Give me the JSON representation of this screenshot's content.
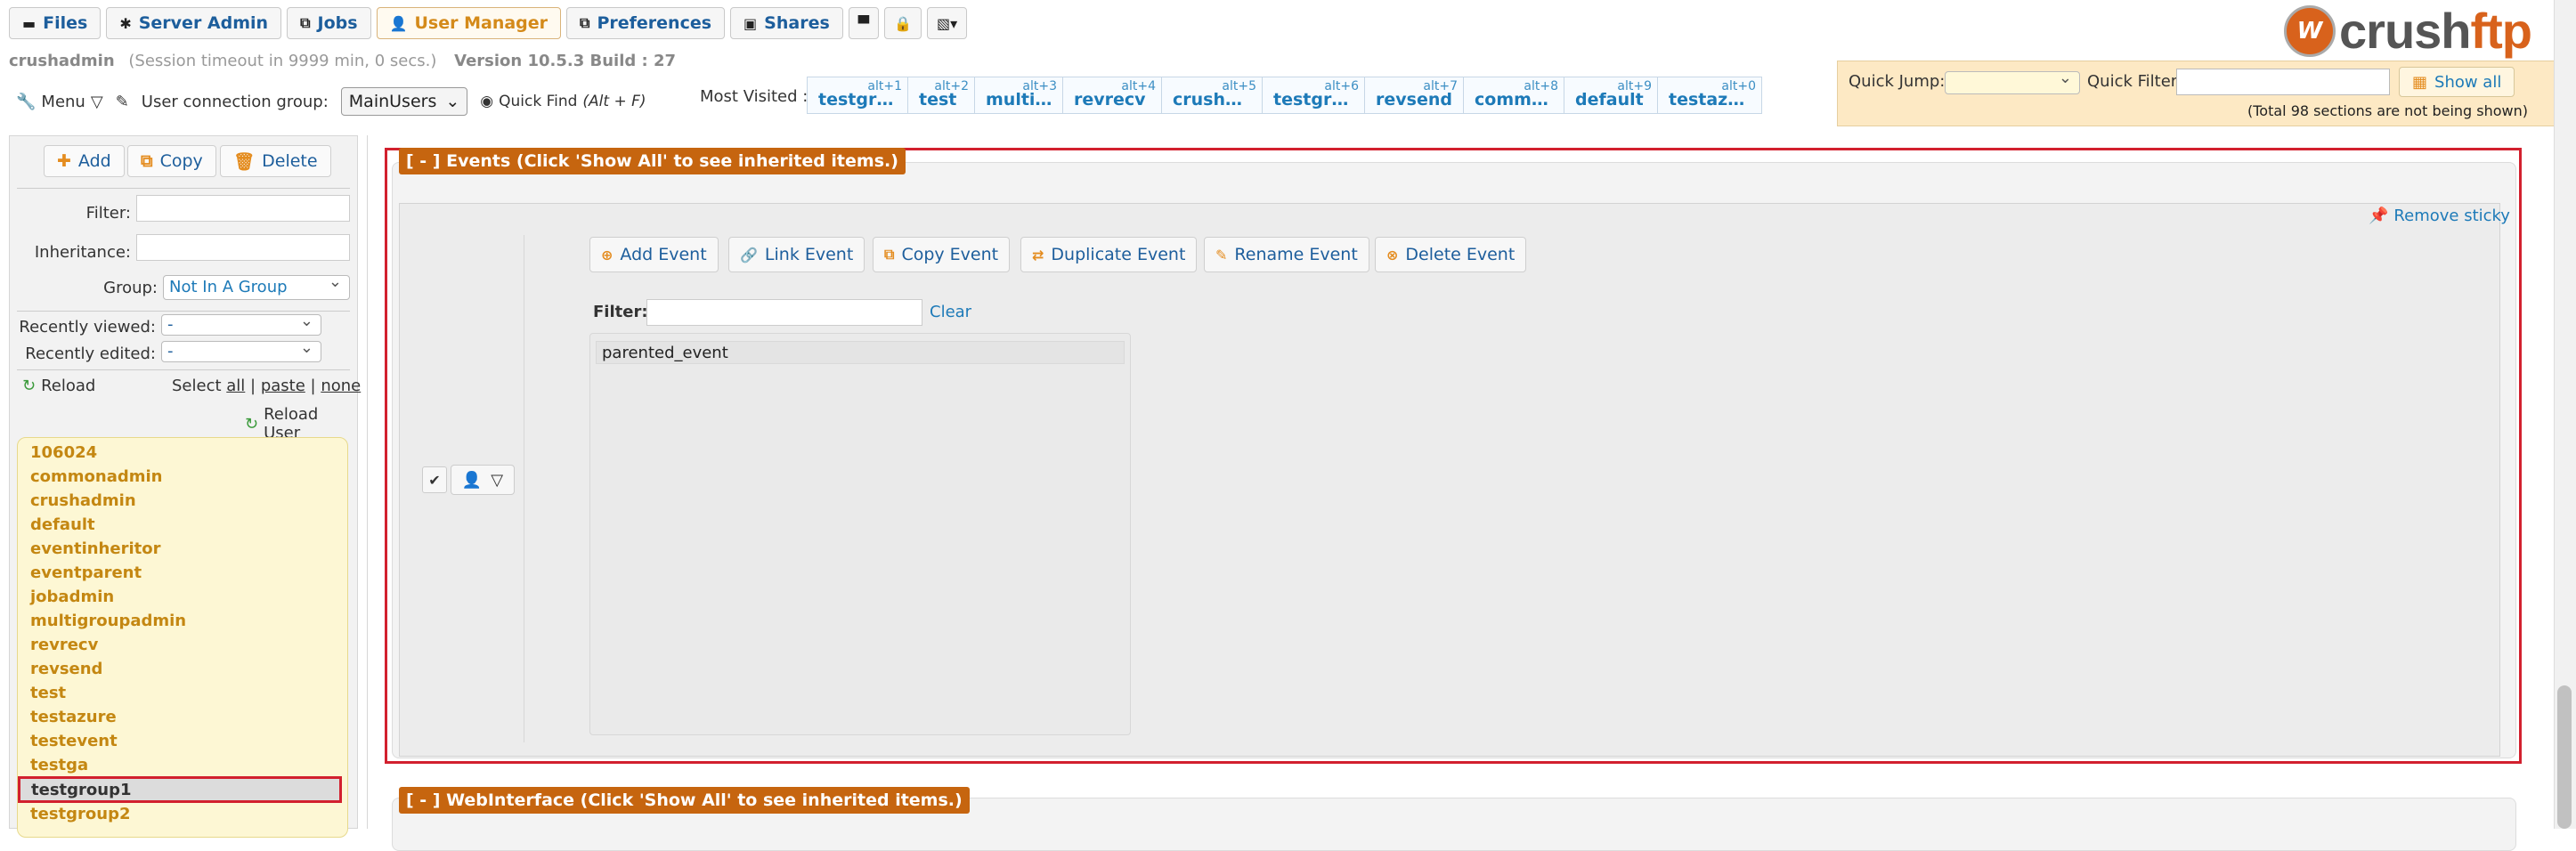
{
  "nav": {
    "tabs": [
      {
        "label": "Files",
        "icon": "folder-icon"
      },
      {
        "label": "Server Admin",
        "icon": "gear-icon"
      },
      {
        "label": "Jobs",
        "icon": "jobs-icon"
      },
      {
        "label": "User Manager",
        "icon": "user-icon",
        "active": true
      },
      {
        "label": "Preferences",
        "icon": "preferences-icon"
      },
      {
        "label": "Shares",
        "icon": "shares-icon"
      }
    ]
  },
  "session": {
    "user": "crushadmin",
    "timeout": "(Session timeout in 9999 min, 0 secs.)",
    "version": "Version 10.5.3 Build : 27"
  },
  "toolbar": {
    "menu": "Menu",
    "group_label": "User connection group:",
    "group_value": "MainUsers",
    "quick_find": "Quick Find",
    "quick_find_shortcut": "(Alt + F)"
  },
  "most_visited": {
    "label": "Most Visited :",
    "items": [
      {
        "name": "testgr…",
        "alt": "alt+1"
      },
      {
        "name": "test",
        "alt": "alt+2"
      },
      {
        "name": "multi…",
        "alt": "alt+3"
      },
      {
        "name": "revrecv",
        "alt": "alt+4"
      },
      {
        "name": "crush…",
        "alt": "alt+5"
      },
      {
        "name": "testgr…",
        "alt": "alt+6"
      },
      {
        "name": "revsend",
        "alt": "alt+7"
      },
      {
        "name": "comm…",
        "alt": "alt+8"
      },
      {
        "name": "default",
        "alt": "alt+9"
      },
      {
        "name": "testaz…",
        "alt": "alt+0"
      }
    ]
  },
  "quick": {
    "jump_label": "Quick Jump:",
    "filter_label": "Quick Filter",
    "show_all": "Show all",
    "note": "(Total 98 sections are not being shown)"
  },
  "logo": {
    "text_a": "crush",
    "text_b": "ftp"
  },
  "left": {
    "add": "Add",
    "copy": "Copy",
    "delete": "Delete",
    "filter_label": "Filter:",
    "inheritance_label": "Inheritance:",
    "group_label": "Group:",
    "group_value": "Not In A Group",
    "recent_viewed_label": "Recently viewed:",
    "recent_viewed_value": "-",
    "recent_edited_label": "Recently edited:",
    "recent_edited_value": "-",
    "reload": "Reload",
    "select_label": "Select",
    "select_all": "all",
    "select_paste": "paste",
    "select_none": "none",
    "reload_user": "Reload User",
    "users": [
      "106024",
      "commonadmin",
      "crushadmin",
      "default",
      "eventinheritor",
      "eventparent",
      "jobadmin",
      "multigroupadmin",
      "revrecv",
      "revsend",
      "test",
      "testazure",
      "testevent",
      "testga",
      "testgroup1",
      "testgroup2"
    ],
    "selected_user": "testgroup1"
  },
  "events": {
    "title": "[ - ] Events (Click 'Show All' to see inherited items.)",
    "remove_sticky": "Remove sticky",
    "buttons": [
      "Add Event",
      "Link Event",
      "Copy Event",
      "Duplicate Event",
      "Rename Event",
      "Delete Event"
    ],
    "filter_label": "Filter:",
    "clear": "Clear",
    "items": [
      "parented_event"
    ]
  },
  "webinterface": {
    "title": "[ - ] WebInterface (Click 'Show All' to see inherited items.)"
  },
  "colors": {
    "accent": "#1d7ab8",
    "active_tab": "#d48a1a",
    "section_header": "#c6650f",
    "highlight_border": "#d2202e",
    "user_list_bg": "#fdf7d4"
  }
}
